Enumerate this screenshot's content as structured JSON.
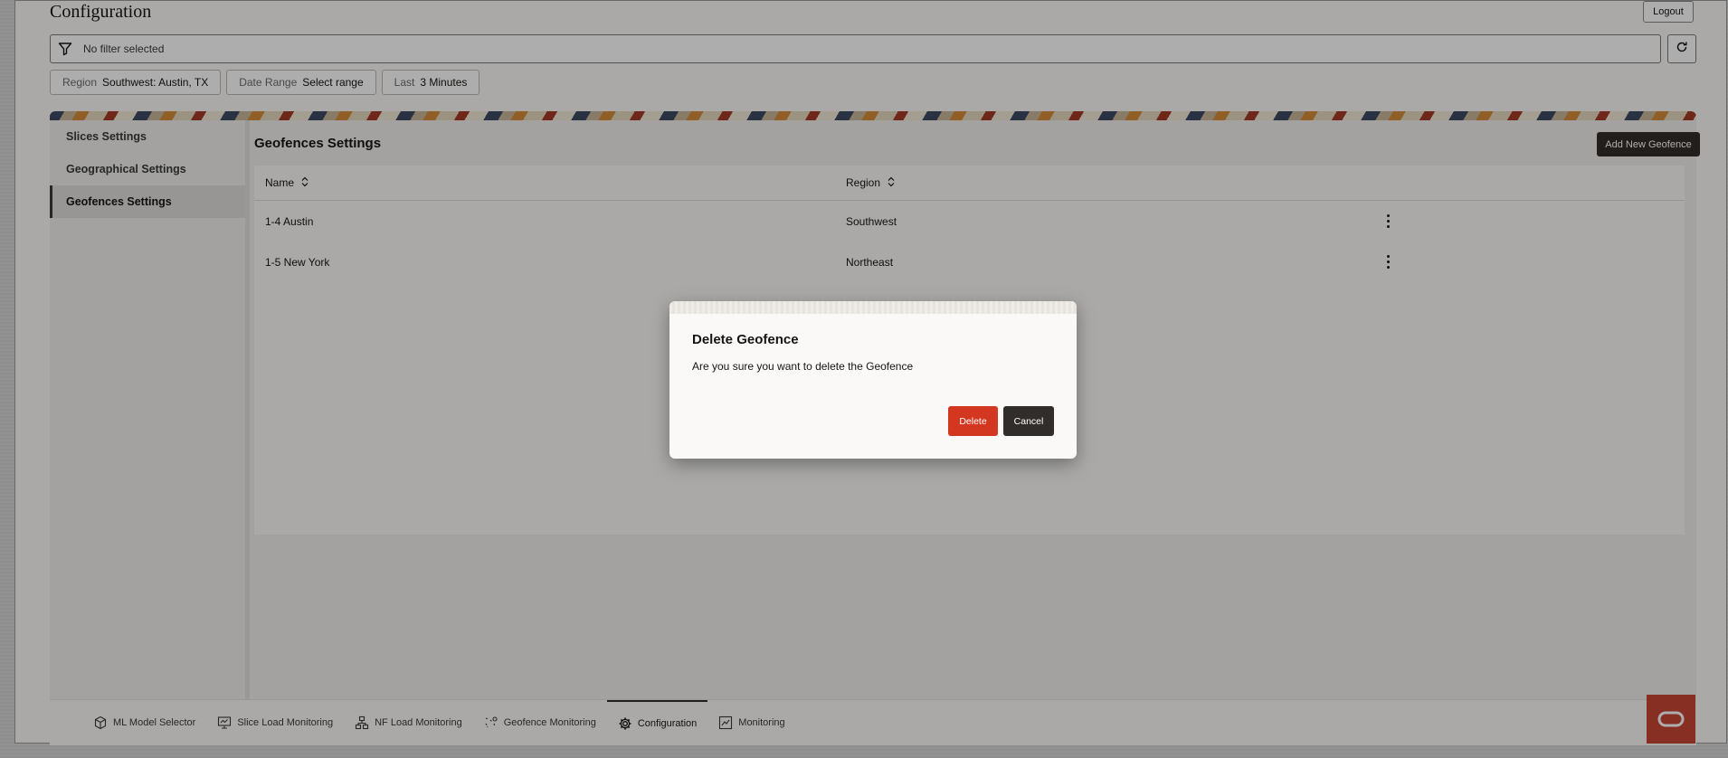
{
  "header": {
    "title": "Configuration",
    "logout_label": "Logout"
  },
  "filter": {
    "text": "No filter selected"
  },
  "chips": [
    {
      "label": "Region",
      "value": "Southwest: Austin, TX"
    },
    {
      "label": "Date Range",
      "value": "Select range"
    },
    {
      "label": "Last",
      "value": "3 Minutes"
    }
  ],
  "sidebar": {
    "items": [
      {
        "label": "Slices Settings"
      },
      {
        "label": "Geographical Settings"
      },
      {
        "label": "Geofences Settings"
      }
    ]
  },
  "content": {
    "title": "Geofences Settings",
    "add_button": "Add New Geofence",
    "columns": [
      "Name",
      "Region"
    ],
    "rows": [
      {
        "name": "1-4 Austin",
        "region": "Southwest"
      },
      {
        "name": "1-5 New York",
        "region": "Northeast"
      }
    ]
  },
  "bottom_nav": {
    "items": [
      {
        "label": "ML Model Selector",
        "icon": "cube-icon"
      },
      {
        "label": "Slice Load Monitoring",
        "icon": "monitor-icon"
      },
      {
        "label": "NF Load Monitoring",
        "icon": "network-icon"
      },
      {
        "label": "Geofence Monitoring",
        "icon": "geofence-icon"
      },
      {
        "label": "Configuration",
        "icon": "gear-icon"
      },
      {
        "label": "Monitoring",
        "icon": "chart-icon"
      }
    ],
    "active": "Configuration"
  },
  "dialog": {
    "title": "Delete Geofence",
    "message": "Are you sure you want to delete the Geofence",
    "delete_label": "Delete",
    "cancel_label": "Cancel"
  },
  "colors": {
    "accent_dark": "#312d2a",
    "danger": "#d3371f",
    "brand": "#c74634"
  }
}
